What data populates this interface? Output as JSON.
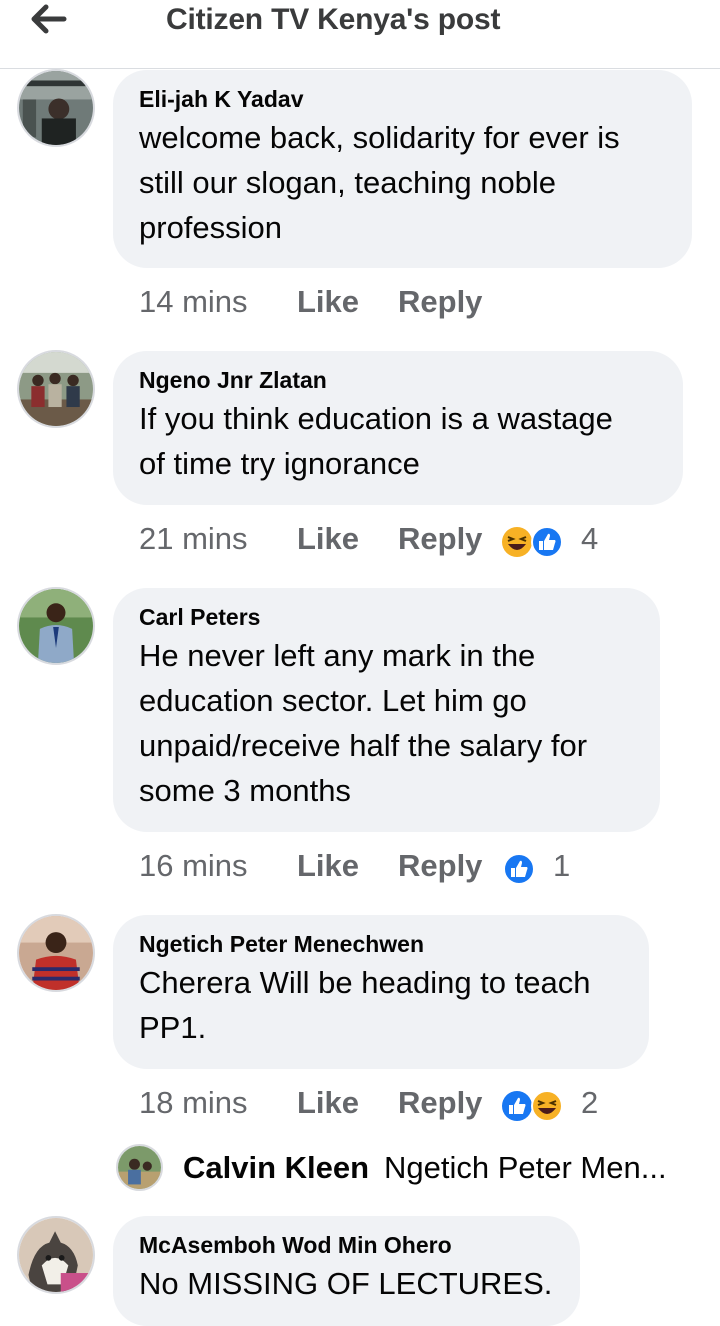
{
  "header": {
    "title": "Citizen TV Kenya's post",
    "back_icon": "arrow-left-icon"
  },
  "comments": [
    {
      "author": "Eli-jah K Yadav",
      "lines": [
        "welcome back, solidarity for ever is",
        "still our slogan, teaching noble",
        "profession"
      ],
      "time": "14 mins",
      "like": "Like",
      "reply": "Reply",
      "reactions": [],
      "reaction_count": ""
    },
    {
      "author": "Ngeno Jnr Zlatan",
      "lines": [
        "If you think education is a wastage",
        "of time try ignorance"
      ],
      "time": "21 mins",
      "like": "Like",
      "reply": "Reply",
      "reactions": [
        "haha-icon",
        "like-icon"
      ],
      "reaction_count": "4"
    },
    {
      "author": "Carl Peters",
      "lines": [
        "He never left any mark in the",
        "education sector. Let him go",
        "unpaid/receive half the salary for",
        "some 3 months"
      ],
      "time": "16 mins",
      "like": "Like",
      "reply": "Reply",
      "reactions": [
        "like-icon"
      ],
      "reaction_count": "1"
    },
    {
      "author": "Ngetich Peter Menechwen",
      "lines": [
        "Cherera Will be heading to teach",
        "PP1."
      ],
      "time": "18 mins",
      "like": "Like",
      "reply": "Reply",
      "reactions": [
        "like-icon",
        "haha-icon"
      ],
      "reaction_count": "2"
    },
    {
      "author": "McAsemboh Wod Min Ohero",
      "lines": [
        "No MISSING OF LECTURES."
      ],
      "time": "",
      "like": "",
      "reply": "",
      "reactions": [],
      "reaction_count": ""
    }
  ],
  "reply_preview": {
    "author": "Calvin Kleen",
    "snippet": "Ngetich Peter Men..."
  },
  "colors": {
    "like_blue": "#1877f2",
    "haha_yellow": "#f7b125",
    "bubble": "#f0f2f5",
    "meta_gray": "#65676b"
  }
}
